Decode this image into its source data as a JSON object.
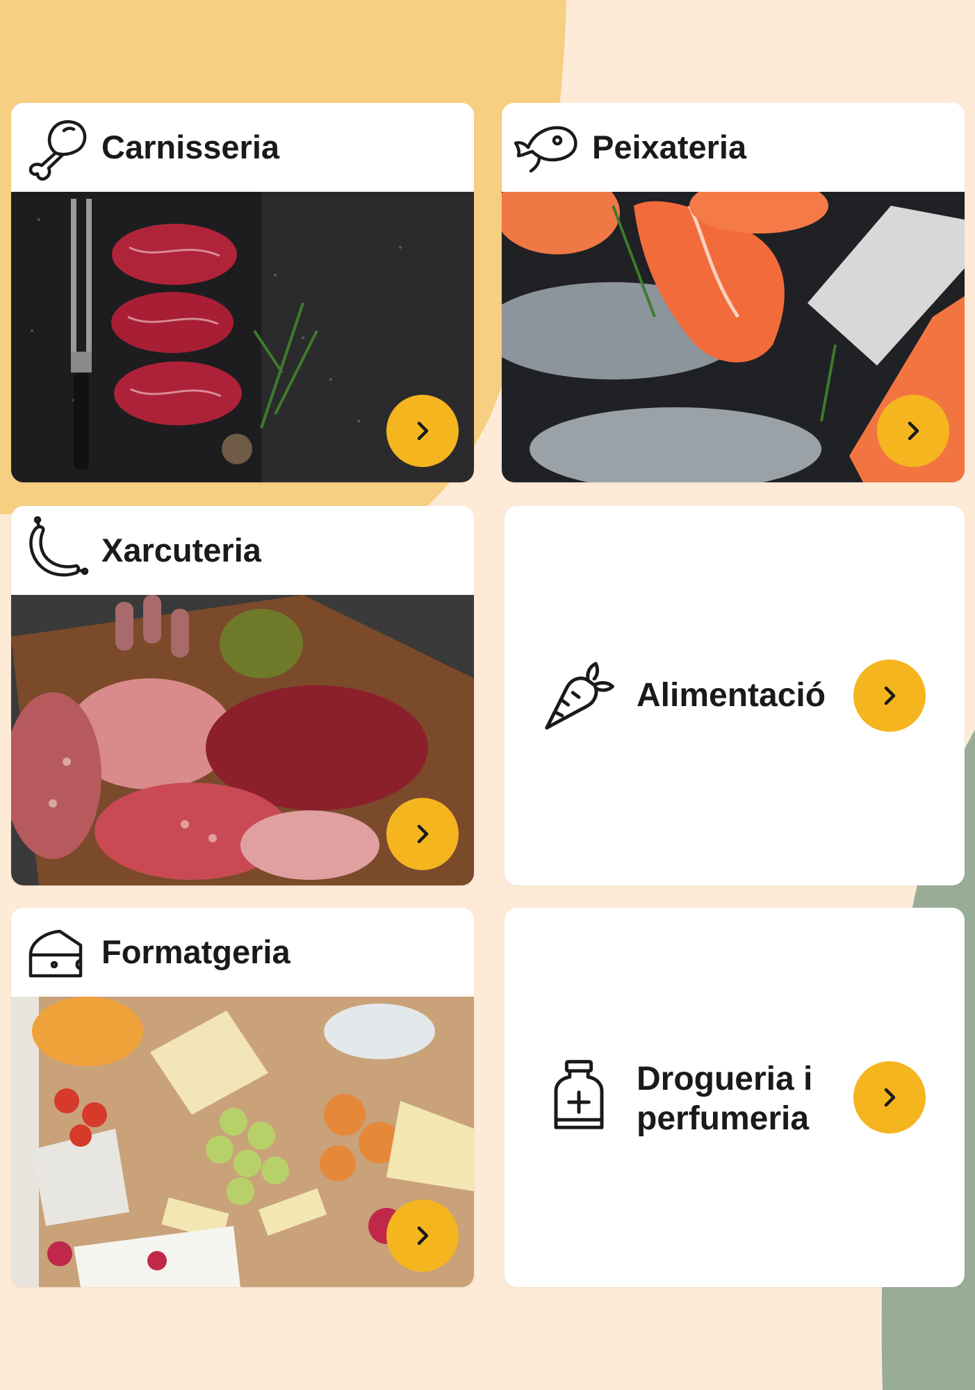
{
  "colors": {
    "page_background": "#fdebd8",
    "accent_yellow": "#f5b51f",
    "blob_orange": "#f7cf83",
    "blob_green": "#98ad96",
    "card": "#ffffff",
    "text": "#1a1a1a"
  },
  "categories": [
    {
      "title": "Carnisseria",
      "icon": "chicken-leg-icon",
      "has_photo": true,
      "photo": "raw-steaks-photo"
    },
    {
      "title": "Peixateria",
      "icon": "fish-icon",
      "has_photo": true,
      "photo": "salmon-and-fish-photo"
    },
    {
      "title": "Xarcuteria",
      "icon": "sausage-icon",
      "has_photo": true,
      "photo": "cured-meats-board-photo"
    },
    {
      "title": "Alimentació",
      "icon": "carrot-icon",
      "has_photo": false
    },
    {
      "title": "Formatgeria",
      "icon": "cheese-icon",
      "has_photo": true,
      "photo": "cheese-board-photo"
    },
    {
      "title": "Drogueria i perfumeria",
      "title_lines": [
        "Drogueria i",
        "perfumeria"
      ],
      "icon": "medicine-bottle-icon",
      "has_photo": false
    }
  ],
  "button_icon": "chevron-right-icon"
}
